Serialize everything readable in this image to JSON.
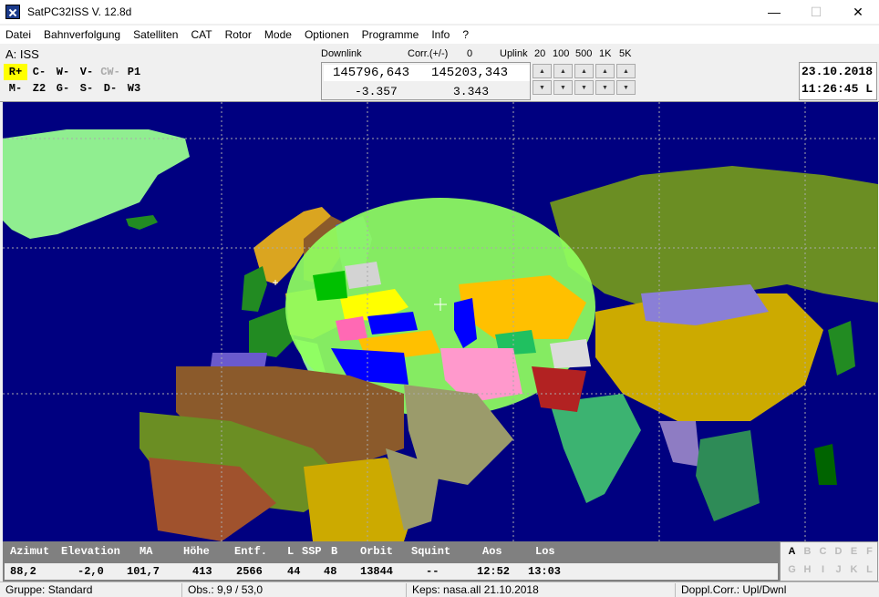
{
  "window": {
    "title": "SatPC32ISS V. 12.8d",
    "minimize": "—",
    "maximize": "☐",
    "close": "✕"
  },
  "menu": [
    "Datei",
    "Bahnverfolgung",
    "Satelliten",
    "CAT",
    "Rotor",
    "Mode",
    "Optionen",
    "Programme",
    "Info",
    "?"
  ],
  "satellite": {
    "label": "A: ISS"
  },
  "modes": {
    "row1": [
      "R+",
      "C-",
      "W-",
      "V-",
      "CW-",
      "P1"
    ],
    "row2": [
      "M-",
      "Z2",
      "G-",
      "S-",
      "D-",
      "W3"
    ]
  },
  "freq_header": {
    "downlink": "Downlink",
    "corr": "Corr.(+/-)",
    "corr_value": "0",
    "uplink": "Uplink",
    "steps": [
      "20",
      "100",
      "500",
      "1K",
      "5K"
    ]
  },
  "frequency": {
    "downlink": "145796,643",
    "uplink": "145203,343",
    "downlink_doppler": "-3.357",
    "uplink_doppler": "3.343"
  },
  "step_buttons": {
    "up": "▲",
    "down": "▼"
  },
  "datetime": {
    "date": "23.10.2018",
    "time": "11:26:45 L"
  },
  "data_panel": {
    "headers": [
      "Azimut",
      "Elevation",
      "MA",
      "Höhe",
      "Entf.",
      "L",
      "SSP",
      "B",
      "Orbit",
      "Squint",
      "Aos",
      "Los"
    ],
    "values": [
      "88,2",
      "-2,0",
      "101,7",
      "413",
      "2566",
      "44",
      "48",
      "13844",
      "--",
      "12:52",
      "13:03"
    ]
  },
  "letters": {
    "row1": [
      "A",
      "B",
      "C",
      "D",
      "E",
      "F"
    ],
    "row2": [
      "G",
      "H",
      "I",
      "J",
      "K",
      "L"
    ],
    "active": "A"
  },
  "status": {
    "group": "Gruppe: Standard",
    "obs": "Obs.: 9,9 / 53,0",
    "keps": "Keps: nasa.all 21.10.2018",
    "doppler": "Doppl.Corr.: Upl/Dwnl"
  },
  "colors": {
    "ocean": "#000080",
    "footprint": "#90ff60",
    "highlight": "#ffff00",
    "data_panel": "#808080"
  }
}
